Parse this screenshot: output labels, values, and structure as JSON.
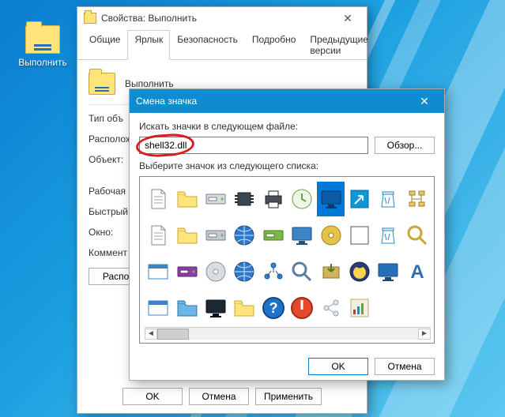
{
  "desktop": {
    "icon_label": "Выполнить"
  },
  "props": {
    "title": "Свойства: Выполнить",
    "tabs": [
      "Общие",
      "Ярлык",
      "Безопасность",
      "Подробно",
      "Предыдущие версии"
    ],
    "active_tab": 1,
    "name_value": "Выполнить",
    "labels": {
      "type": "Тип объ",
      "location": "Располож",
      "target": "Объект:",
      "workdir": "Рабочая п",
      "hotkey": "Быстрый",
      "window": "Окно:",
      "comment": "Коммент"
    },
    "location_btn": "Распол",
    "footer": {
      "ok": "OK",
      "cancel": "Отмена",
      "apply": "Применить"
    }
  },
  "icondlg": {
    "title": "Смена значка",
    "label_search": "Искать значки в следующем файле:",
    "input_value": "shell32.dll",
    "browse": "Обзор...",
    "label_pick": "Выберите значок из следующего списка:",
    "ok": "OK",
    "cancel": "Отмена",
    "icons": [
      {
        "name": "blank-doc-icon",
        "fill": "#fff",
        "stroke": "#888"
      },
      {
        "name": "folder-icon",
        "fill": "#ffe47a",
        "stroke": "#c9a638"
      },
      {
        "name": "drive-icon",
        "fill": "#d7dbe0",
        "stroke": "#7a828c"
      },
      {
        "name": "chip-icon",
        "fill": "#3b4654",
        "stroke": "#222"
      },
      {
        "name": "printer-icon",
        "fill": "#4a4f57",
        "stroke": "#222"
      },
      {
        "name": "clock-history-icon",
        "fill": "#eef7e6",
        "stroke": "#6fa04a"
      },
      {
        "name": "monitor-filled-icon",
        "fill": "#0b5aa6",
        "stroke": "#083a6b",
        "selected": true
      },
      {
        "name": "arrow-link-icon",
        "fill": "#0d97d6",
        "stroke": "#0a6a98"
      },
      {
        "name": "recycle-bin-icon",
        "fill": "#fff",
        "stroke": "#2a87c9"
      },
      {
        "name": "tree-icon",
        "fill": "#e7c966",
        "stroke": "#9b8030"
      },
      {
        "name": "rich-doc-icon",
        "fill": "#fff",
        "stroke": "#888"
      },
      {
        "name": "folder-open-icon",
        "fill": "#ffe47a",
        "stroke": "#c9a638"
      },
      {
        "name": "drive-stack-icon",
        "fill": "#c3c9cf",
        "stroke": "#7a828c"
      },
      {
        "name": "globe-icon",
        "fill": "#2e79c9",
        "stroke": "#15467e"
      },
      {
        "name": "network-drive-icon",
        "fill": "#7fb845",
        "stroke": "#4e7b22"
      },
      {
        "name": "screen-icon",
        "fill": "#3a84c8",
        "stroke": "#1f5284"
      },
      {
        "name": "cd-open-icon",
        "fill": "#e6c24a",
        "stroke": "#a27f1e"
      },
      {
        "name": "shortcut-overlay-icon",
        "fill": "#fff",
        "stroke": "#555"
      },
      {
        "name": "recycle-full-icon",
        "fill": "#fff",
        "stroke": "#2a87c9"
      },
      {
        "name": "folder-search-icon",
        "fill": "#ffe47a",
        "stroke": "#c9a638"
      },
      {
        "name": "window-icon",
        "fill": "#fff",
        "stroke": "#3a84c8"
      },
      {
        "name": "removable-drive-icon",
        "fill": "#8b3fa8",
        "stroke": "#5a2670"
      },
      {
        "name": "cd-icon",
        "fill": "#d9dde2",
        "stroke": "#8a9199"
      },
      {
        "name": "internet-globe-icon",
        "fill": "#2e79c9",
        "stroke": "#15467e"
      },
      {
        "name": "network-small-icon",
        "fill": "#3a84c8",
        "stroke": "#1f5284"
      },
      {
        "name": "search-icon",
        "fill": "#eef3f8",
        "stroke": "#5a7fa3"
      },
      {
        "name": "installer-icon",
        "fill": "#d0b35a",
        "stroke": "#8d7426"
      },
      {
        "name": "sleep-icon",
        "fill": "#2e3a72",
        "stroke": "#18204a"
      },
      {
        "name": "display-icon",
        "fill": "#2770b9",
        "stroke": "#144a80"
      },
      {
        "name": "font-icon",
        "fill": "#2f6fb3",
        "stroke": "#184a7e"
      },
      {
        "name": "run-dialog-icon",
        "fill": "#fff",
        "stroke": "#3a84c8"
      },
      {
        "name": "network-folder-icon",
        "fill": "#6bb6e6",
        "stroke": "#2c77ad"
      },
      {
        "name": "monitor-flat-icon",
        "fill": "#1b2733",
        "stroke": "#0c141d"
      },
      {
        "name": "folder-yellow-icon",
        "fill": "#ffe47a",
        "stroke": "#c9a638"
      },
      {
        "name": "help-icon",
        "fill": "#1e73c8",
        "stroke": "#12488a"
      },
      {
        "name": "shutdown-icon",
        "fill": "#e34a2b",
        "stroke": "#a52d14"
      },
      {
        "name": "share-icon",
        "fill": "#dfe7ee",
        "stroke": "#8fa4b6"
      },
      {
        "name": "key-chart-icon",
        "fill": "#f2efe0",
        "stroke": "#b4ac7e"
      },
      {
        "name": "blank-icon",
        "fill": "transparent",
        "stroke": "transparent"
      },
      {
        "name": "blank-icon",
        "fill": "transparent",
        "stroke": "transparent"
      }
    ]
  }
}
